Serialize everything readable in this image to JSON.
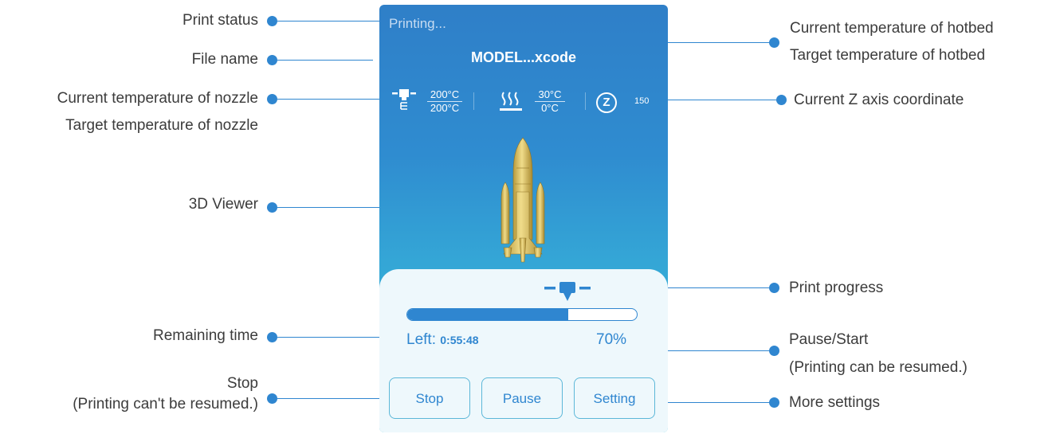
{
  "screen": {
    "status": "Printing...",
    "file_name": "MODEL...xcode",
    "nozzle": {
      "current": "200°C",
      "target": "200°C"
    },
    "hotbed": {
      "current": "30°C",
      "target": "0°C"
    },
    "z_letter": "Z",
    "z_value": "150",
    "progress_percent_value": 70,
    "remaining_label": "Left:",
    "remaining_time": "0:55:48",
    "progress_text": "70%",
    "buttons": {
      "stop": "Stop",
      "pause": "Pause",
      "setting": "Setting"
    },
    "icons": [
      "nozzle-icon",
      "hotbed-icon",
      "z-axis-icon",
      "rocket-model",
      "nozzle-marker-icon"
    ]
  },
  "annotations": {
    "print_status": "Print status",
    "file_name": "File name",
    "nozzle_current": "Current temperature of nozzle",
    "nozzle_target": "Target temperature of nozzle",
    "viewer": "3D Viewer",
    "remaining_time": "Remaining time",
    "stop_1": "Stop",
    "stop_2": "(Printing can't be resumed.)",
    "hotbed_current": "Current temperature of hotbed",
    "hotbed_target": "Target temperature of hotbed",
    "z_axis": "Current Z axis coordinate",
    "progress": "Print progress",
    "pause_1": "Pause/Start",
    "pause_2": "(Printing can be resumed.)",
    "more_settings": "More settings"
  },
  "colors": {
    "accent": "#2f86d0",
    "screen_top": "#2f7fc8",
    "screen_bottom": "#33bcd8",
    "model": "#d9c06a"
  }
}
